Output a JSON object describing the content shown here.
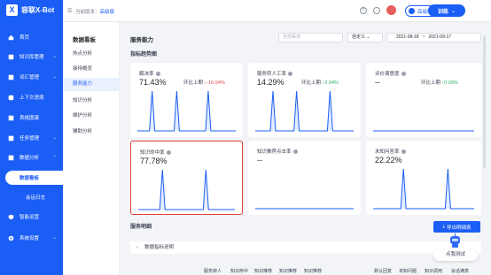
{
  "app": {
    "logo_text": "容联X-Bot"
  },
  "header": {
    "version_label": "当前版本：",
    "version_value": "高级版",
    "edition_label": "高级版",
    "train_label": "训练"
  },
  "sidebar": {
    "items": [
      {
        "label": "首页",
        "icon": "home-icon"
      },
      {
        "label": "知识库管理",
        "icon": "book-icon"
      },
      {
        "label": "词汇管理",
        "icon": "dictionary-icon"
      },
      {
        "label": "上下文语境",
        "icon": "context-icon"
      },
      {
        "label": "表格图谱",
        "icon": "table-icon"
      },
      {
        "label": "任务管理",
        "icon": "task-icon"
      },
      {
        "label": "数据分析",
        "icon": "chart-icon"
      },
      {
        "label": "数据看板",
        "icon": ""
      },
      {
        "label": "会话日志",
        "icon": ""
      },
      {
        "label": "智能运营",
        "icon": "shield-icon"
      },
      {
        "label": "系统设置",
        "icon": "gear-icon"
      }
    ]
  },
  "submenu": {
    "title": "数据看板",
    "items": [
      "热点分析",
      "接待概览",
      "服务能力",
      "知识分析",
      "维护分析",
      "辅助分析"
    ],
    "active_index": 2
  },
  "main": {
    "title": "服务能力",
    "filter_placeholder": "全部渠道",
    "range_label": "自定义",
    "date_start": "2021-08-18",
    "date_sep": "~",
    "date_end": "2021-09-17",
    "trend_title": "指标趋势图",
    "detail_title": "服务明细",
    "export_label": "导出明细表",
    "explain_label": "数据指标说明",
    "table_headers": [
      "服务转人",
      "知识命中",
      "知识推荐",
      "知识推荐",
      "知识推荐",
      "默认回复",
      "未知问题",
      "知识调用",
      "会话满意"
    ]
  },
  "cards": [
    {
      "label": "解决率",
      "value": "71.43%",
      "compare_label": "环比上期",
      "compare_value": "-16.94%",
      "direction": "down",
      "spikes": [
        0.15,
        0.4,
        0.72
      ]
    },
    {
      "label": "服务转人工率",
      "value": "14.29%",
      "compare_label": "环比上期",
      "compare_value": "2.04%",
      "direction": "up",
      "spikes": [
        0.18,
        0.42,
        0.76
      ]
    },
    {
      "label": "评价满意度",
      "value": "--",
      "compare_label": "环比上期",
      "compare_value": "0.00%",
      "direction": "up",
      "spikes": []
    },
    {
      "label": "知识命中率",
      "value": "77.78%",
      "compare_label": "",
      "compare_value": "",
      "direction": "",
      "spikes": [
        0.25,
        0.7
      ]
    },
    {
      "label": "知识推荐点击率",
      "value": "--",
      "compare_label": "",
      "compare_value": "",
      "direction": "",
      "spikes": []
    },
    {
      "label": "未知问答率",
      "value": "22.22%",
      "compare_label": "",
      "compare_value": "",
      "direction": "",
      "spikes": [
        0.3,
        0.74
      ]
    }
  ],
  "assistant": {
    "label": "点我测试"
  },
  "colors": {
    "brand": "#1b5ef5",
    "down": "#e64545",
    "up": "#23b05b",
    "highlight": "#e03c3c"
  }
}
